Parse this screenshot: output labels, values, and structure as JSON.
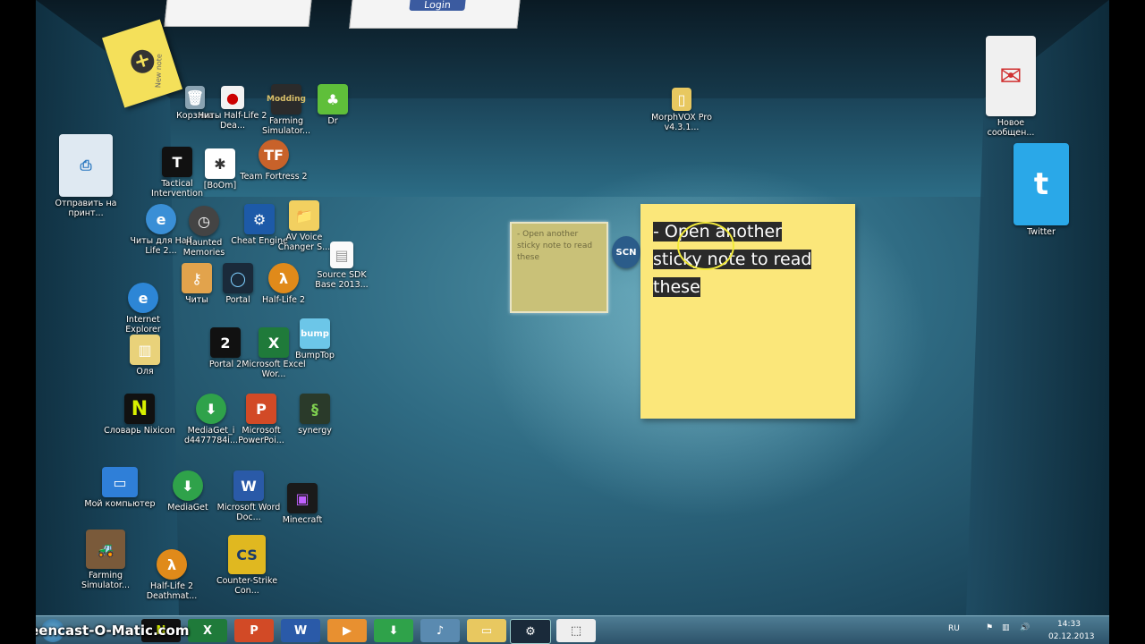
{
  "top_cards": {
    "login_label": "Login"
  },
  "new_note": {
    "label": "New note"
  },
  "desktop_icons": [
    {
      "label": "Корзина",
      "icon": "recycle-bin-icon"
    },
    {
      "label": "Читы Half-Life 2 Dea...",
      "icon": "cheats-icon"
    },
    {
      "label": "Farming Simulator...",
      "icon": "farming-sim-icon"
    },
    {
      "label": "Dr",
      "icon": "dr-icon"
    },
    {
      "label": "Tactical Intervention",
      "icon": "tactical-intervention-icon"
    },
    {
      "label": "[BoOm]",
      "icon": "boom-icon"
    },
    {
      "label": "Team Fortress 2",
      "icon": "tf2-icon"
    },
    {
      "label": "Отправить на принт...",
      "icon": "printer-icon"
    },
    {
      "label": "Читы для Half Life 2...",
      "icon": "ie-shortcut-icon"
    },
    {
      "label": "Haunted Memories",
      "icon": "haunted-memories-icon"
    },
    {
      "label": "Cheat Engine",
      "icon": "cheat-engine-icon"
    },
    {
      "label": "AV Voice Changer S...",
      "icon": "folder-icon"
    },
    {
      "label": "Source SDK Base 2013...",
      "icon": "document-icon"
    },
    {
      "label": "Читы",
      "icon": "key-icon"
    },
    {
      "label": "Portal",
      "icon": "portal-icon"
    },
    {
      "label": "Half-Life 2",
      "icon": "half-life-icon"
    },
    {
      "label": "Internet Explorer",
      "icon": "internet-explorer-icon"
    },
    {
      "label": "Оля",
      "icon": "folder-stack-icon"
    },
    {
      "label": "Portal 2",
      "icon": "portal2-icon"
    },
    {
      "label": "Microsoft Excel Wor...",
      "icon": "excel-icon"
    },
    {
      "label": "BumpTop",
      "icon": "bumptop-icon"
    },
    {
      "label": "Словарь Nixicon",
      "icon": "nixicon-icon"
    },
    {
      "label": "MediaGet_i d4477784i...",
      "icon": "mediaget-icon"
    },
    {
      "label": "Microsoft PowerPoi...",
      "icon": "powerpoint-icon"
    },
    {
      "label": "synergy",
      "icon": "synergy-icon"
    },
    {
      "label": "Мой компьютер",
      "icon": "computer-icon"
    },
    {
      "label": "MediaGet",
      "icon": "mediaget-icon"
    },
    {
      "label": "Microsoft Word Doc...",
      "icon": "word-icon"
    },
    {
      "label": "Minecraft",
      "icon": "minecraft-icon"
    },
    {
      "label": "Farming Simulator...",
      "icon": "farming-sim-icon"
    },
    {
      "label": "Half-Life 2 Deathmat...",
      "icon": "half-life-icon"
    },
    {
      "label": "Counter-Strike Con...",
      "icon": "counter-strike-icon"
    },
    {
      "label": "MorphVOX Pro v4.3.1...",
      "icon": "folder-icon"
    },
    {
      "label": "Новое сообщен...",
      "icon": "mail-icon"
    },
    {
      "label": "Twitter",
      "icon": "twitter-icon"
    }
  ],
  "sticky_small": {
    "text": "- Open another sticky note to read these"
  },
  "sticky_big": {
    "line1": "- Open another",
    "line2": "sticky note to read",
    "line3": "these"
  },
  "taskbar": {
    "watermark": "Screencast-O-Matic.com",
    "lang": "RU",
    "time": "14:33",
    "date": "02.12.2013"
  }
}
